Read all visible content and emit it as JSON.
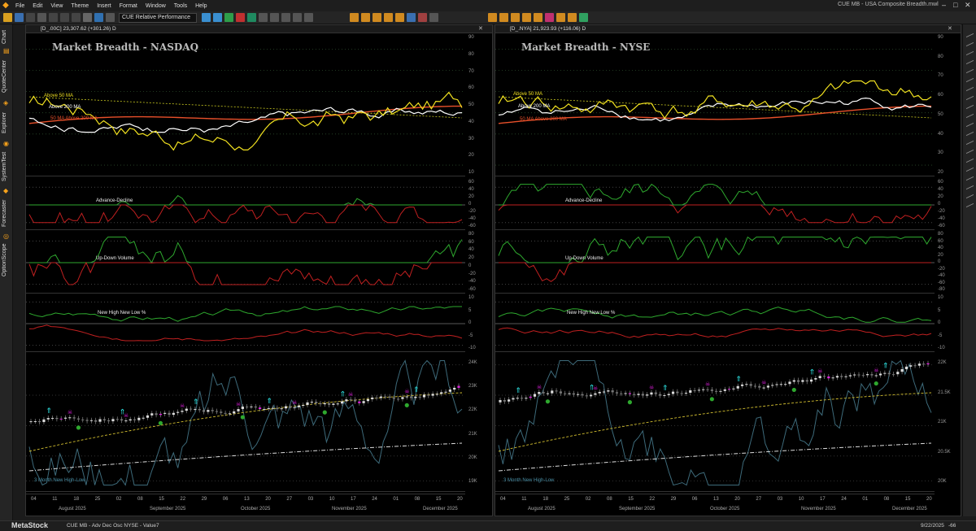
{
  "menu": [
    "File",
    "Edit",
    "View",
    "Theme",
    "Insert",
    "Format",
    "Window",
    "Tools",
    "Help"
  ],
  "window_title": "CUE MB - USA Composite Breadth.mwl",
  "layout_selector": "CUE Relative Performance",
  "sidebar_tabs": [
    "Chart",
    "QuoteCenter",
    "Explorer",
    "SystemTest",
    "Forecaster",
    "OptionScope"
  ],
  "colors": {
    "accent": "#f7a21b",
    "above50": "#f0e020",
    "above200": "#ffffff",
    "ma50above200": "#e8502a",
    "adv": "#2ea82e",
    "dec": "#c02020",
    "magenta": "#e020e0",
    "cyan": "#30f0f0"
  },
  "charts": [
    {
      "header": "[D_.00C] 23,307.62 (+301.26) D",
      "title": "Market Breadth - NASDAQ",
      "legend_above50": "Above 50 MA",
      "legend_above200": "Above 200 MA",
      "legend_ma": "50 MA Above 200 MA",
      "ad_label": "Advance-Decline",
      "ud_label": "Up-Down Volume",
      "hl_label": "New High New Low %",
      "hl3m_label": "3 Month New High-Low",
      "breadth_ticks": [
        "90",
        "80",
        "70",
        "60",
        "50",
        "40",
        "30",
        "20",
        "10"
      ],
      "ad_ticks": [
        "60",
        "40",
        "20",
        "0",
        "-20",
        "-40",
        "-60"
      ],
      "ud_ticks": [
        "80",
        "60",
        "40",
        "20",
        "0",
        "-20",
        "-40",
        "-60"
      ],
      "hl_ticks": [
        "10",
        "5",
        "0",
        "-5",
        "-10"
      ],
      "price_ticks": [
        "24K",
        "23K",
        "22K",
        "21K",
        "20K",
        "19K"
      ],
      "days": [
        "04",
        "11",
        "18",
        "25",
        "02",
        "08",
        "15",
        "22",
        "29",
        "06",
        "13",
        "20",
        "27",
        "03",
        "10",
        "17",
        "24",
        "01",
        "08",
        "15",
        "20"
      ],
      "months": [
        "August 2025",
        "September 2025",
        "October 2025",
        "November 2025",
        "December 2025"
      ]
    },
    {
      "header": "[D_.NYA] 21,923.93 (+116.06) D",
      "title": "Market Breadth - NYSE",
      "legend_above50": "Above 50 MA",
      "legend_above200": "Above 200 MA",
      "legend_ma": "50 MA Above 200 MA",
      "ad_label": "Advance-Decline",
      "ud_label": "Up-Down Volume",
      "hl_label": "New High New Low %",
      "hl3m_label": "3 Month New High-Low",
      "breadth_ticks": [
        "90",
        "80",
        "70",
        "60",
        "50",
        "40",
        "30",
        "20"
      ],
      "ad_ticks": [
        "60",
        "40",
        "20",
        "0",
        "-20",
        "-40",
        "-60"
      ],
      "ud_ticks": [
        "80",
        "60",
        "40",
        "20",
        "0",
        "-20",
        "-40",
        "-60",
        "-80"
      ],
      "hl_ticks": [
        "10",
        "5",
        "0",
        "-5",
        "-10"
      ],
      "price_ticks": [
        "22K",
        "21.5K",
        "21K",
        "20.5K",
        "20K"
      ],
      "days": [
        "04",
        "11",
        "18",
        "25",
        "02",
        "08",
        "15",
        "22",
        "29",
        "06",
        "13",
        "20",
        "27",
        "03",
        "10",
        "17",
        "24",
        "01",
        "08",
        "15",
        "20"
      ],
      "months": [
        "August 2025",
        "September 2025",
        "October 2025",
        "November 2025",
        "December 2025"
      ]
    }
  ],
  "status": {
    "logo": "MetaStock",
    "text": "CUE MB - Adv Dec Osc NYSE - Value7",
    "date": "9/22/2025",
    "value": "-66"
  }
}
